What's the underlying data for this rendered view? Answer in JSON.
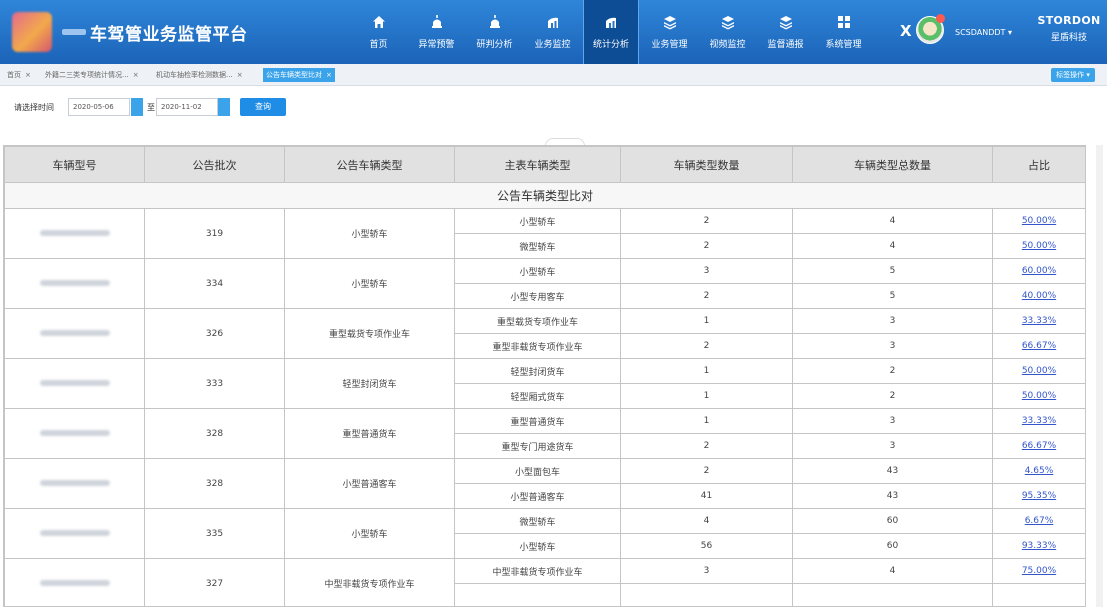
{
  "header": {
    "app_title": "车驾管业务监管平台",
    "nav": [
      {
        "label": "首页",
        "icon": "home-icon"
      },
      {
        "label": "异常预警",
        "icon": "alarm-icon"
      },
      {
        "label": "研判分析",
        "icon": "alarm-icon"
      },
      {
        "label": "业务监控",
        "icon": "chart-icon"
      },
      {
        "label": "统计分析",
        "icon": "chart-icon",
        "active": true
      },
      {
        "label": "业务管理",
        "icon": "layers-icon"
      },
      {
        "label": "视频监控",
        "icon": "layers-icon"
      },
      {
        "label": "监督通报",
        "icon": "layers-icon"
      },
      {
        "label": "系统管理",
        "icon": "grid-icon"
      }
    ],
    "close_label": "X",
    "username": "SCSDANDDT ▾",
    "brand_en": "STORDON",
    "brand_cn": "星盾科技"
  },
  "tabs": [
    {
      "label": "首页",
      "close": "×"
    },
    {
      "label": "外籍二三类专项统计情况...",
      "close": "×"
    },
    {
      "label": "机动车抽检率检测数据...",
      "close": "×"
    },
    {
      "label": "公告车辆类型比对",
      "close": "×",
      "active": true
    }
  ],
  "tab_ops_label": "标签操作 ▾",
  "filter": {
    "label": "请选择时间",
    "start_date": "2020-05-06",
    "to_label": "至",
    "end_date": "2020-11-02",
    "query_label": "查询"
  },
  "table": {
    "caption": "公告车辆类型比对",
    "columns": [
      "车辆型号",
      "公告批次",
      "公告车辆类型",
      "主表车辆类型",
      "车辆类型数量",
      "车辆类型总数量",
      "占比"
    ],
    "groups": [
      {
        "batch": "319",
        "announce_type": "小型轿车",
        "rows": [
          {
            "main_type": "小型轿车",
            "count": "2",
            "total": "4",
            "ratio": "50.00%"
          },
          {
            "main_type": "微型轿车",
            "count": "2",
            "total": "4",
            "ratio": "50.00%"
          }
        ]
      },
      {
        "batch": "334",
        "announce_type": "小型轿车",
        "rows": [
          {
            "main_type": "小型轿车",
            "count": "3",
            "total": "5",
            "ratio": "60.00%"
          },
          {
            "main_type": "小型专用客车",
            "count": "2",
            "total": "5",
            "ratio": "40.00%"
          }
        ]
      },
      {
        "batch": "326",
        "announce_type": "重型载货专项作业车",
        "rows": [
          {
            "main_type": "重型载货专项作业车",
            "count": "1",
            "total": "3",
            "ratio": "33.33%"
          },
          {
            "main_type": "重型非载货专项作业车",
            "count": "2",
            "total": "3",
            "ratio": "66.67%"
          }
        ]
      },
      {
        "batch": "333",
        "announce_type": "轻型封闭货车",
        "rows": [
          {
            "main_type": "轻型封闭货车",
            "count": "1",
            "total": "2",
            "ratio": "50.00%"
          },
          {
            "main_type": "轻型厢式货车",
            "count": "1",
            "total": "2",
            "ratio": "50.00%"
          }
        ]
      },
      {
        "batch": "328",
        "announce_type": "重型普通货车",
        "rows": [
          {
            "main_type": "重型普通货车",
            "count": "1",
            "total": "3",
            "ratio": "33.33%"
          },
          {
            "main_type": "重型专门用途货车",
            "count": "2",
            "total": "3",
            "ratio": "66.67%"
          }
        ]
      },
      {
        "batch": "328",
        "announce_type": "小型普通客车",
        "rows": [
          {
            "main_type": "小型面包车",
            "count": "2",
            "total": "43",
            "ratio": "4.65%"
          },
          {
            "main_type": "小型普通客车",
            "count": "41",
            "total": "43",
            "ratio": "95.35%"
          }
        ]
      },
      {
        "batch": "335",
        "announce_type": "小型轿车",
        "rows": [
          {
            "main_type": "微型轿车",
            "count": "4",
            "total": "60",
            "ratio": "6.67%"
          },
          {
            "main_type": "小型轿车",
            "count": "56",
            "total": "60",
            "ratio": "93.33%"
          }
        ]
      },
      {
        "batch": "327",
        "announce_type": "中型非载货专项作业车",
        "rows": [
          {
            "main_type": "中型非载货专项作业车",
            "count": "3",
            "total": "4",
            "ratio": "75.00%"
          },
          {
            "main_type": "",
            "count": "",
            "total": "",
            "ratio": ""
          }
        ]
      }
    ]
  }
}
